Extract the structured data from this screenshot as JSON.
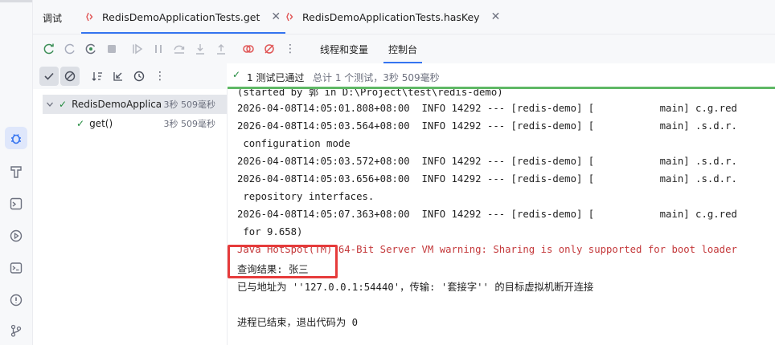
{
  "debug_panel": {
    "title": "调试",
    "tabs": [
      {
        "label": "RedisDemoApplicationTests.get",
        "active": true
      },
      {
        "label": "RedisDemoApplicationTests.hasKey",
        "active": false
      }
    ],
    "close_glyph": "✕"
  },
  "toolbar": {
    "subtabs": [
      {
        "label": "线程和变量",
        "active": false
      },
      {
        "label": "控制台",
        "active": true
      }
    ],
    "more_glyph": "⋮"
  },
  "status": {
    "summary": "1 测试已通过",
    "detail": "总计 1 个测试，3秒 509毫秒",
    "accent": "#5fb865"
  },
  "tree": {
    "root": {
      "label": "RedisDemoApplica",
      "time": "3秒 509毫秒"
    },
    "child": {
      "label": "get()",
      "time": "3秒 509毫秒"
    }
  },
  "console": {
    "lines": [
      "(started by 郭 in D:\\Project\\test\\redis-demo)",
      "2026-04-08T14:05:01.808+08:00  INFO 14292 --- [redis-demo] [           main] c.g.red",
      "2026-04-08T14:05:03.564+08:00  INFO 14292 --- [redis-demo] [           main] .s.d.r.",
      " configuration mode",
      "2026-04-08T14:05:03.572+08:00  INFO 14292 --- [redis-demo] [           main] .s.d.r.",
      "2026-04-08T14:05:03.656+08:00  INFO 14292 --- [redis-demo] [           main] .s.d.r.",
      " repository interfaces.",
      "2026-04-08T14:05:07.363+08:00  INFO 14292 --- [redis-demo] [           main] c.g.red",
      " for 9.658)",
      "Java HotSpot(TM) 64-Bit Server VM warning: Sharing is only supported for boot loader",
      "查询结果: 张三",
      "已与地址为 ''127.0.0.1:54440'，传输: '套接字'' 的目标虚拟机断开连接",
      "",
      "进程已结束，退出代码为 0"
    ],
    "warning_color": "#c4393b"
  },
  "left_bar_icons": [
    "debug-icon",
    "build-icon",
    "terminal-run-icon",
    "run-icon",
    "terminal-icon",
    "problems-icon",
    "git-icon"
  ]
}
